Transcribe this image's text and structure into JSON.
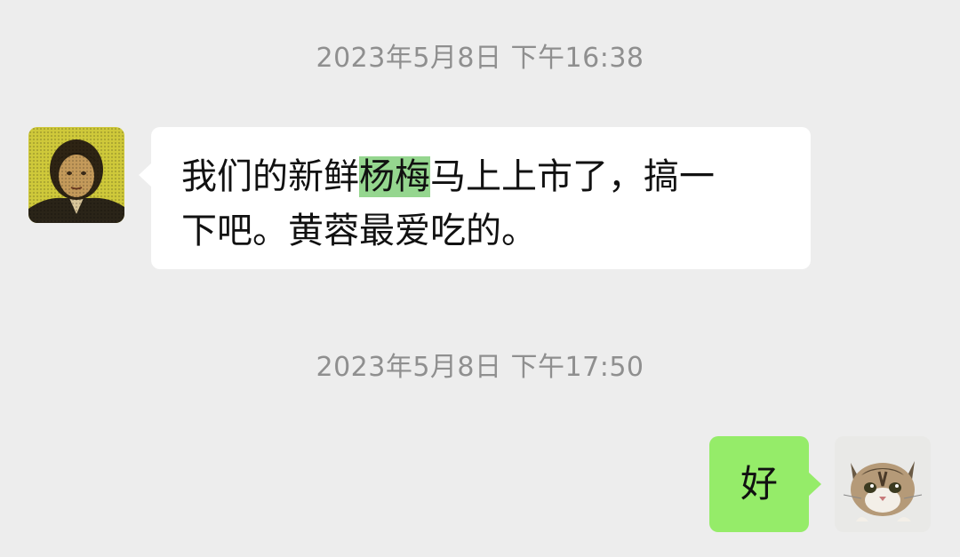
{
  "chat": {
    "messages": [
      {
        "timestamp": "2023年5月8日 下午16:38",
        "sender": "contact",
        "avatar": "person-avatar",
        "text_before": "我们的新鲜",
        "text_highlight": "杨梅",
        "text_line1_after": "马上上市了，搞一",
        "text_line2": "下吧。黄蓉最爱吃的。",
        "bubble_color": "#ffffff",
        "highlight_color": "#95d68f"
      },
      {
        "timestamp": "2023年5月8日 下午17:50",
        "sender": "self",
        "avatar": "cat-avatar",
        "text": "好",
        "bubble_color": "#95ec69"
      }
    ]
  },
  "colors": {
    "background": "#ededed",
    "timestamp_text": "#8f8f8f"
  }
}
